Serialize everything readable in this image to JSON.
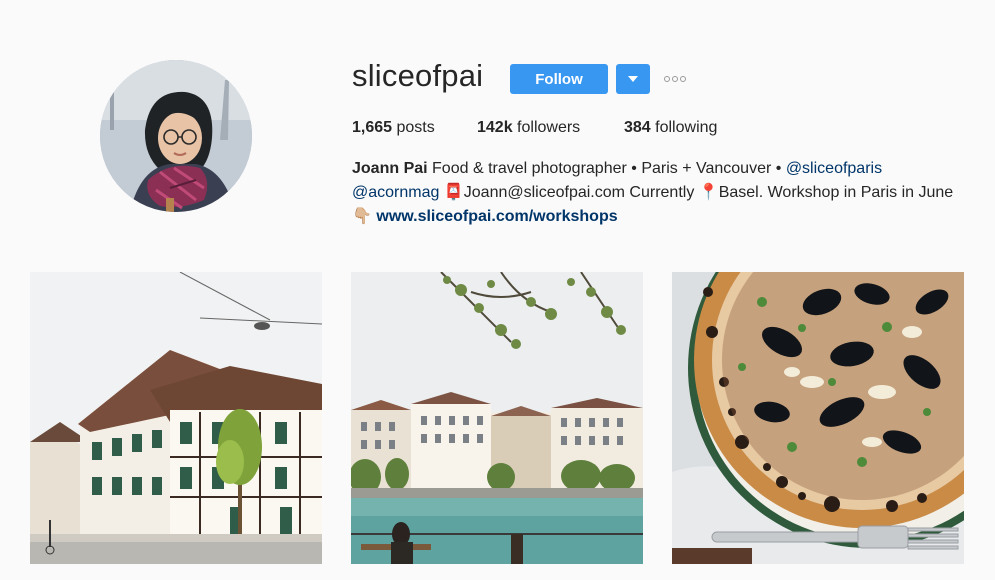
{
  "profile": {
    "username": "sliceofpai",
    "follow_label": "Follow",
    "more_label": "...",
    "stats": {
      "posts_count": "1,665",
      "posts_label": "posts",
      "followers_count": "142k",
      "followers_label": "followers",
      "following_count": "384",
      "following_label": "following"
    },
    "bio": {
      "name": "Joann Pai",
      "line1_text": "Food & travel photographer • Paris + Vancouver •",
      "mention1": "@sliceofparis",
      "mention2": "@acornmag",
      "email_emoji": "📮",
      "email_text": "Joann@sliceofpai.com Currently",
      "pin_emoji": "📍",
      "location_text": "Basel. Workshop in Paris in June",
      "point_emoji": "👇🏼",
      "link": "www.sliceofpai.com/workshops"
    }
  },
  "posts": [
    {
      "icon": "street-photo"
    },
    {
      "icon": "river-photo"
    },
    {
      "icon": "pizza-photo"
    }
  ],
  "colors": {
    "accent": "#3897f0",
    "link": "#003569",
    "background": "#fafafa",
    "text": "#262626"
  }
}
